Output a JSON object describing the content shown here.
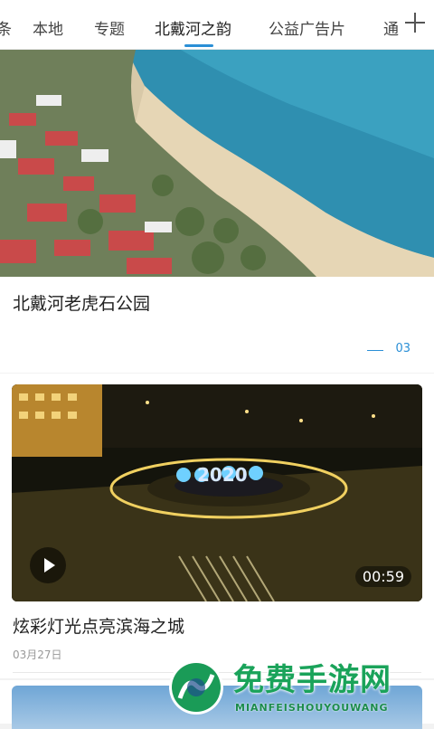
{
  "tabs": {
    "items": [
      "条",
      "本地",
      "专题",
      "北戴河之韵",
      "公益广告片",
      "通"
    ],
    "active": "北戴河之韵"
  },
  "card1": {
    "title": "北戴河老虎石公园",
    "pager": "03"
  },
  "card2": {
    "title": "炫彩灯光点亮滨海之城",
    "date": "03月27日",
    "duration": "00:59",
    "overlay_text": "2020"
  },
  "watermark": {
    "title": "免费手游网",
    "subtitle": "MIANFEISHOUYOUWANG"
  },
  "icons": [
    "plus-icon",
    "play-icon"
  ]
}
